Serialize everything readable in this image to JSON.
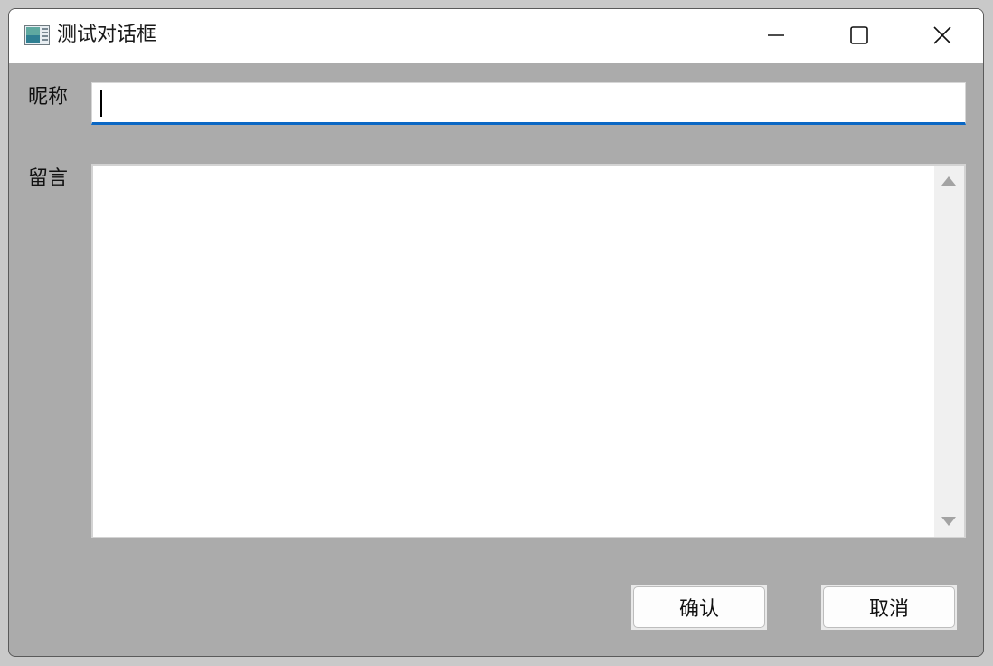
{
  "window": {
    "title": "测试对话框",
    "icon": "app-window-icon",
    "controls": {
      "minimize": "minimize-icon",
      "maximize": "maximize-icon",
      "close": "close-icon"
    }
  },
  "form": {
    "nickname_label": "昵称",
    "nickname_value": "",
    "message_label": "留言",
    "message_value": ""
  },
  "buttons": {
    "confirm_label": "确认",
    "cancel_label": "取消"
  },
  "colors": {
    "focus_underline": "#0a67c4",
    "client_background": "#ababab"
  }
}
